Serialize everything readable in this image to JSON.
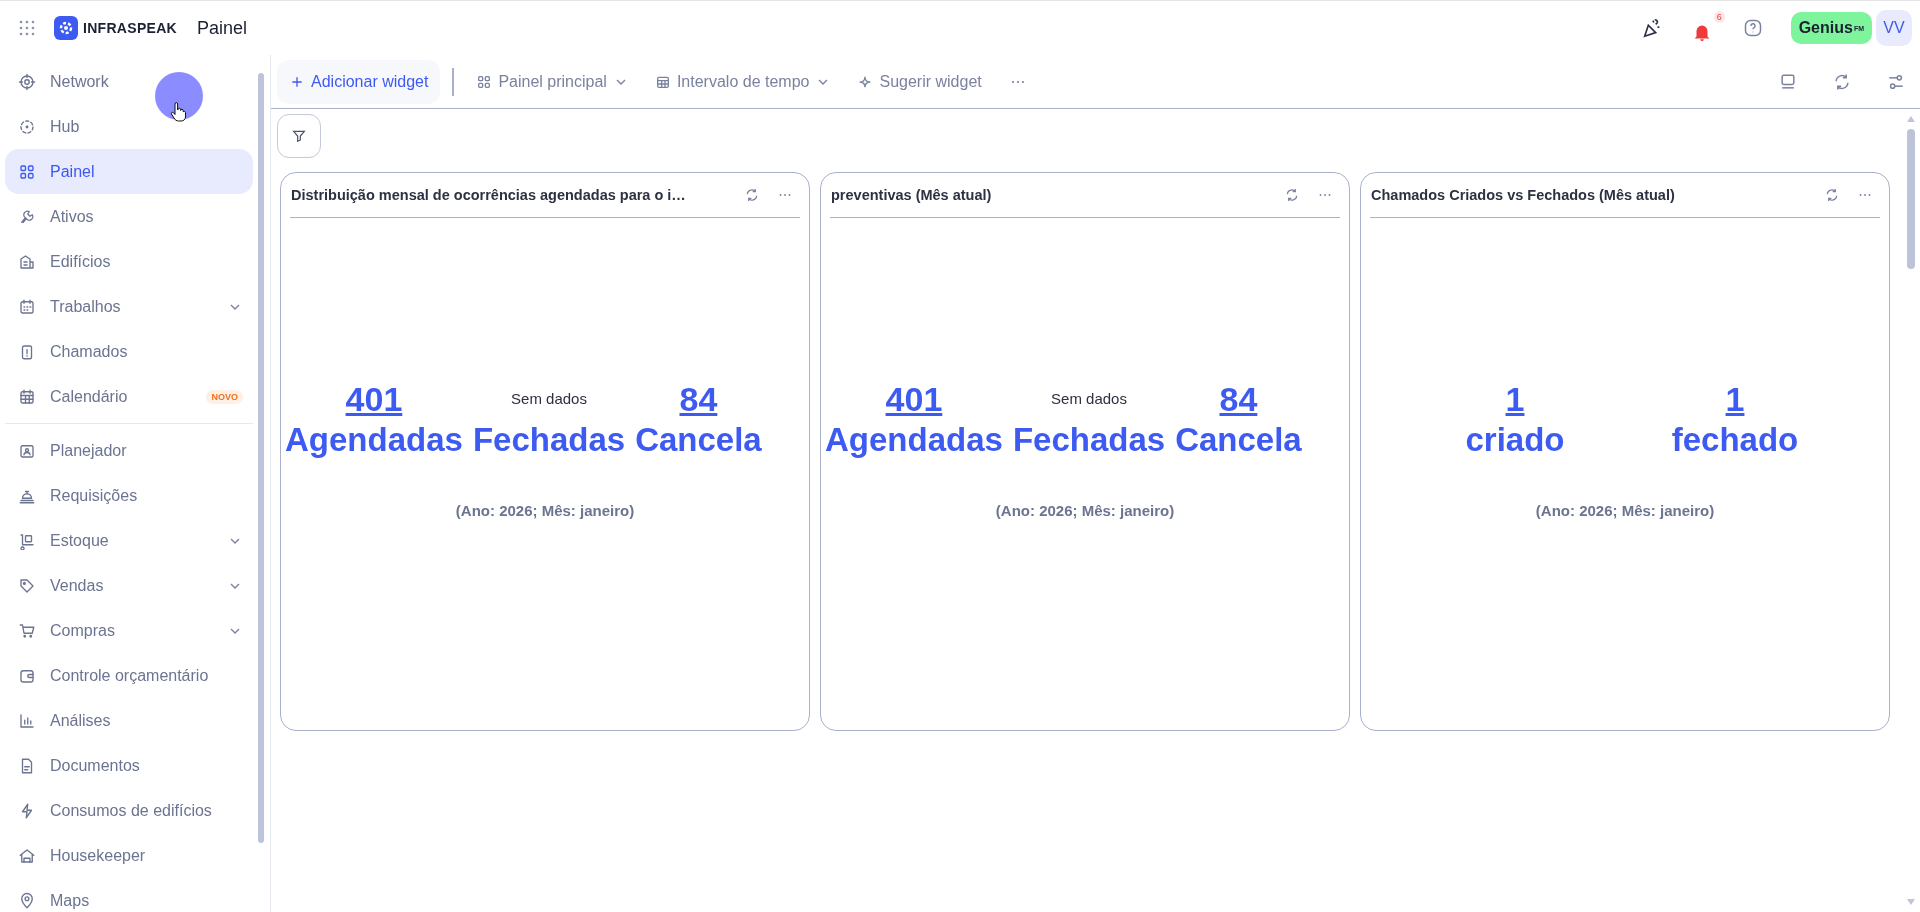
{
  "topbar": {
    "brand": "INFRASPEAK",
    "page_title": "Painel",
    "notifications": "6",
    "plan": "Genius",
    "plan_suffix": "FM",
    "avatar": "VV"
  },
  "sidebar": {
    "sections": [
      {
        "items": [
          {
            "label": "Network",
            "selected": false,
            "expandable": false
          },
          {
            "label": "Hub",
            "selected": false,
            "expandable": false
          },
          {
            "label": "Painel",
            "selected": true,
            "expandable": false
          },
          {
            "label": "Ativos",
            "selected": false,
            "expandable": false
          },
          {
            "label": "Edifícios",
            "selected": false,
            "expandable": false
          },
          {
            "label": "Trabalhos",
            "selected": false,
            "expandable": true
          },
          {
            "label": "Chamados",
            "selected": false,
            "expandable": false
          },
          {
            "label": "Calendário",
            "selected": false,
            "expandable": false,
            "badge": "NOVO"
          }
        ]
      },
      {
        "items": [
          {
            "label": "Planejador",
            "selected": false,
            "expandable": false
          },
          {
            "label": "Requisições",
            "selected": false,
            "expandable": false
          },
          {
            "label": "Estoque",
            "selected": false,
            "expandable": true
          },
          {
            "label": "Vendas",
            "selected": false,
            "expandable": true
          },
          {
            "label": "Compras",
            "selected": false,
            "expandable": true
          },
          {
            "label": "Controle orçamentário",
            "selected": false,
            "expandable": false
          },
          {
            "label": "Análises",
            "selected": false,
            "expandable": false
          },
          {
            "label": "Documentos",
            "selected": false,
            "expandable": false
          },
          {
            "label": "Consumos de edifícios",
            "selected": false,
            "expandable": false
          },
          {
            "label": "Housekeeper",
            "selected": false,
            "expandable": false
          },
          {
            "label": "Maps",
            "selected": false,
            "expandable": false
          }
        ]
      }
    ]
  },
  "toolbar": {
    "add_button": "Adicionar widget",
    "items": [
      {
        "label": "Painel principal",
        "dropdown": true
      },
      {
        "label": "Intervalo de tempo",
        "dropdown": true
      },
      {
        "label": "Sugerir widget",
        "dropdown": false
      }
    ]
  },
  "widgets": [
    {
      "title": "Distribuição mensal de ocorrências agendadas para o i…",
      "metrics": [
        {
          "kind": "number",
          "value": "401",
          "label": "Agendadas"
        },
        {
          "kind": "empty",
          "value": "Sem dados",
          "label": "Fechadas"
        },
        {
          "kind": "number",
          "value": "84",
          "label": "Cancela"
        }
      ],
      "period": "(Ano: 2026; Mês: janeiro)"
    },
    {
      "title": "preventivas (Mês atual)",
      "metrics": [
        {
          "kind": "number",
          "value": "401",
          "label": "Agendadas"
        },
        {
          "kind": "empty",
          "value": "Sem dados",
          "label": "Fechadas"
        },
        {
          "kind": "number",
          "value": "84",
          "label": "Cancela"
        }
      ],
      "period": "(Ano: 2026; Mês: janeiro)"
    },
    {
      "title": "Chamados Criados vs Fechados (Mês atual)",
      "metrics": [
        {
          "kind": "number",
          "value": "1",
          "label": "criado"
        },
        {
          "kind": "number",
          "value": "1",
          "label": "fechado"
        }
      ],
      "period": "(Ano: 2026; Mês: janeiro)"
    }
  ]
}
